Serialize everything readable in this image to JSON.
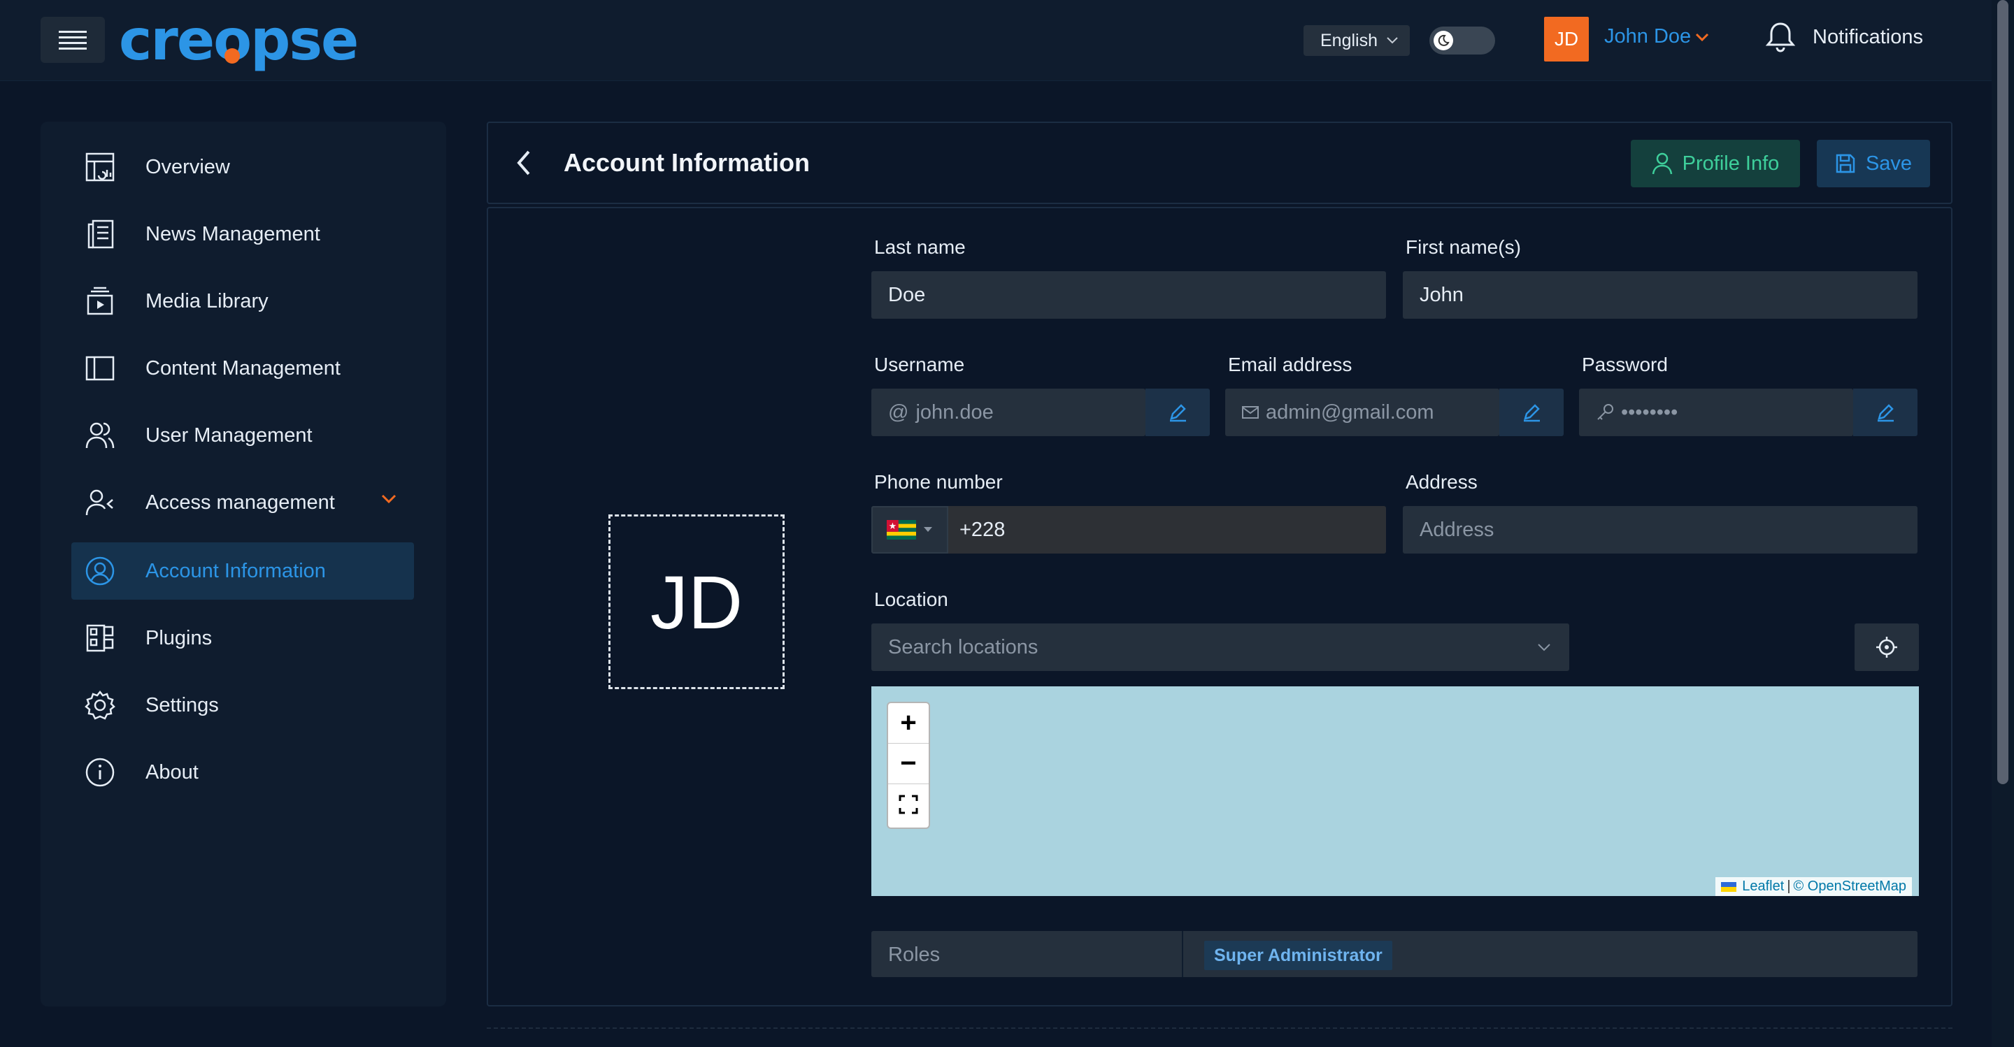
{
  "app": {
    "logo_text": "creopse",
    "language": "English",
    "user_initials": "JD",
    "user_name": "John Doe",
    "notifications_label": "Notifications"
  },
  "sidebar": {
    "items": [
      {
        "label": "Overview",
        "icon": "overview-icon"
      },
      {
        "label": "News Management",
        "icon": "news-icon"
      },
      {
        "label": "Media Library",
        "icon": "media-icon"
      },
      {
        "label": "Content Management",
        "icon": "content-icon"
      },
      {
        "label": "User Management",
        "icon": "users-icon"
      },
      {
        "label": "Access management",
        "icon": "access-icon"
      },
      {
        "label": "Account Information",
        "icon": "account-icon",
        "active": true
      },
      {
        "label": "Plugins",
        "icon": "plugins-icon"
      },
      {
        "label": "Settings",
        "icon": "gear-icon"
      },
      {
        "label": "About",
        "icon": "info-icon"
      }
    ]
  },
  "header": {
    "title": "Account Information",
    "profile_button": "Profile Info",
    "save_button": "Save"
  },
  "form": {
    "avatar_initials": "JD",
    "last_name": {
      "label": "Last name",
      "value": "Doe"
    },
    "first_name": {
      "label": "First name(s)",
      "value": "John"
    },
    "username": {
      "label": "Username",
      "value": "john.doe",
      "prefix": "@"
    },
    "email": {
      "label": "Email address",
      "value": "admin@gmail.com"
    },
    "password": {
      "label": "Password",
      "value": "••••••••"
    },
    "phone": {
      "label": "Phone number",
      "value": "+228"
    },
    "address": {
      "label": "Address",
      "placeholder": "Address"
    },
    "location": {
      "label": "Location",
      "placeholder": "Search locations"
    },
    "roles": {
      "label": "Roles",
      "chips": [
        "Super Administrator"
      ]
    }
  },
  "map": {
    "zoom_in": "+",
    "zoom_out": "−",
    "attribution_leaflet": "Leaflet",
    "attribution_sep": "|",
    "attribution_osm": "© OpenStreetMap"
  },
  "colors": {
    "accent": "#2c95e6",
    "brand_orange": "#f26a21",
    "success": "#3ecf9b"
  }
}
